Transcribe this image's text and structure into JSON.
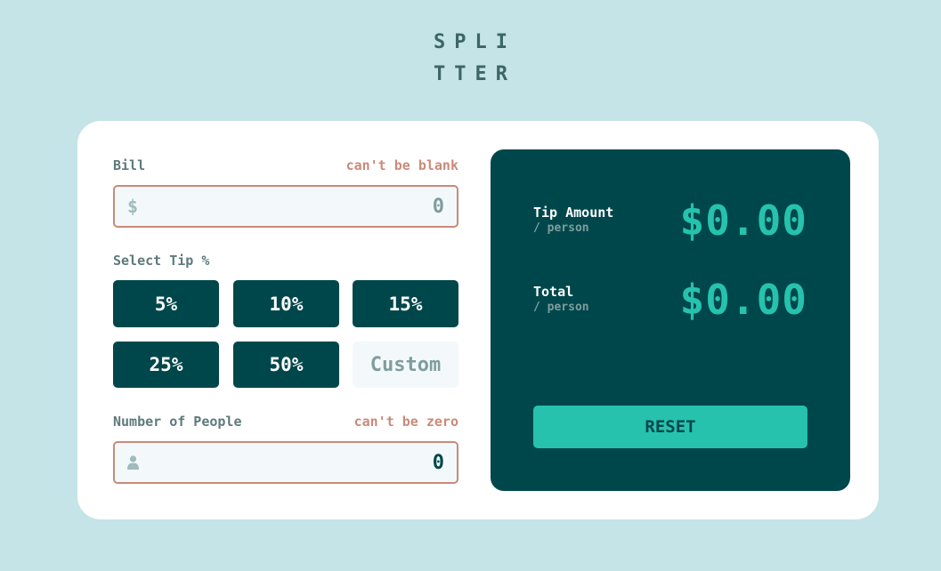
{
  "logo": {
    "line1": "SPLI",
    "line2": "TTER"
  },
  "bill": {
    "label": "Bill",
    "error": "can't be blank",
    "prefix": "$",
    "value": "0"
  },
  "tip": {
    "label": "Select Tip %",
    "options": [
      "5%",
      "10%",
      "15%",
      "25%",
      "50%"
    ],
    "custom_placeholder": "Custom"
  },
  "people": {
    "label": "Number of People",
    "error": "can't be zero",
    "icon": "person-icon",
    "value": "0"
  },
  "results": {
    "tip_amount": {
      "label": "Tip Amount",
      "sub": "/ person",
      "value": "$0.00"
    },
    "total": {
      "label": "Total",
      "sub": "/ person",
      "value": "$0.00"
    },
    "reset_label": "RESET"
  },
  "colors": {
    "background": "#c5e4e7",
    "dark_cyan": "#00474b",
    "strong_cyan": "#26c2ae",
    "error": "#c98a7a"
  }
}
